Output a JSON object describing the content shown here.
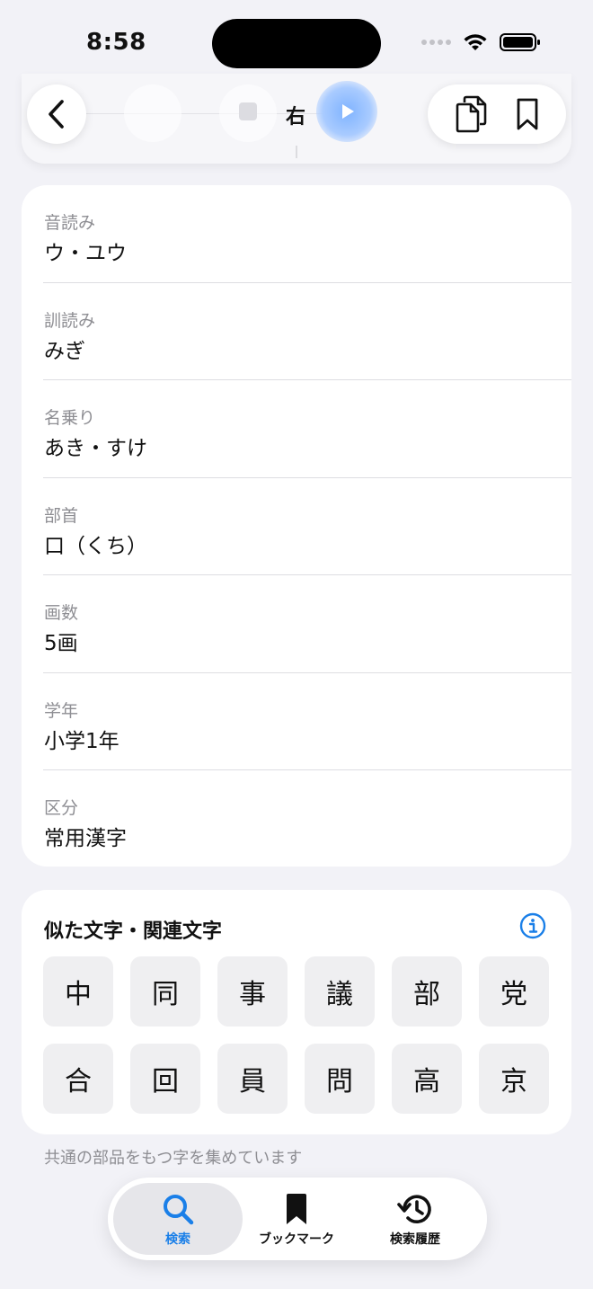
{
  "status": {
    "time": "8:58"
  },
  "header": {
    "kanji": "右"
  },
  "details": [
    {
      "label": "音読み",
      "value": "ウ・ユウ"
    },
    {
      "label": "訓読み",
      "value": "みぎ"
    },
    {
      "label": "名乗り",
      "value": "あき・すけ"
    },
    {
      "label": "部首",
      "value": "口（くち）"
    },
    {
      "label": "画数",
      "value": "5画"
    },
    {
      "label": "学年",
      "value": "小学1年"
    },
    {
      "label": "区分",
      "value": "常用漢字"
    }
  ],
  "related": {
    "title": "似た文字・関連文字",
    "kanji": [
      "中",
      "同",
      "事",
      "議",
      "部",
      "党",
      "合",
      "回",
      "員",
      "問",
      "高",
      "京"
    ],
    "footnote": "共通の部品をもつ字を集めています"
  },
  "tabs": [
    {
      "label": "検索",
      "icon": "search-icon"
    },
    {
      "label": "ブックマーク",
      "icon": "bookmark-icon"
    },
    {
      "label": "検索履歴",
      "icon": "history-icon"
    }
  ],
  "colors": {
    "accent": "#1a7fe8",
    "secondary_text": "#8e8e93",
    "background": "#f2f2f7"
  }
}
